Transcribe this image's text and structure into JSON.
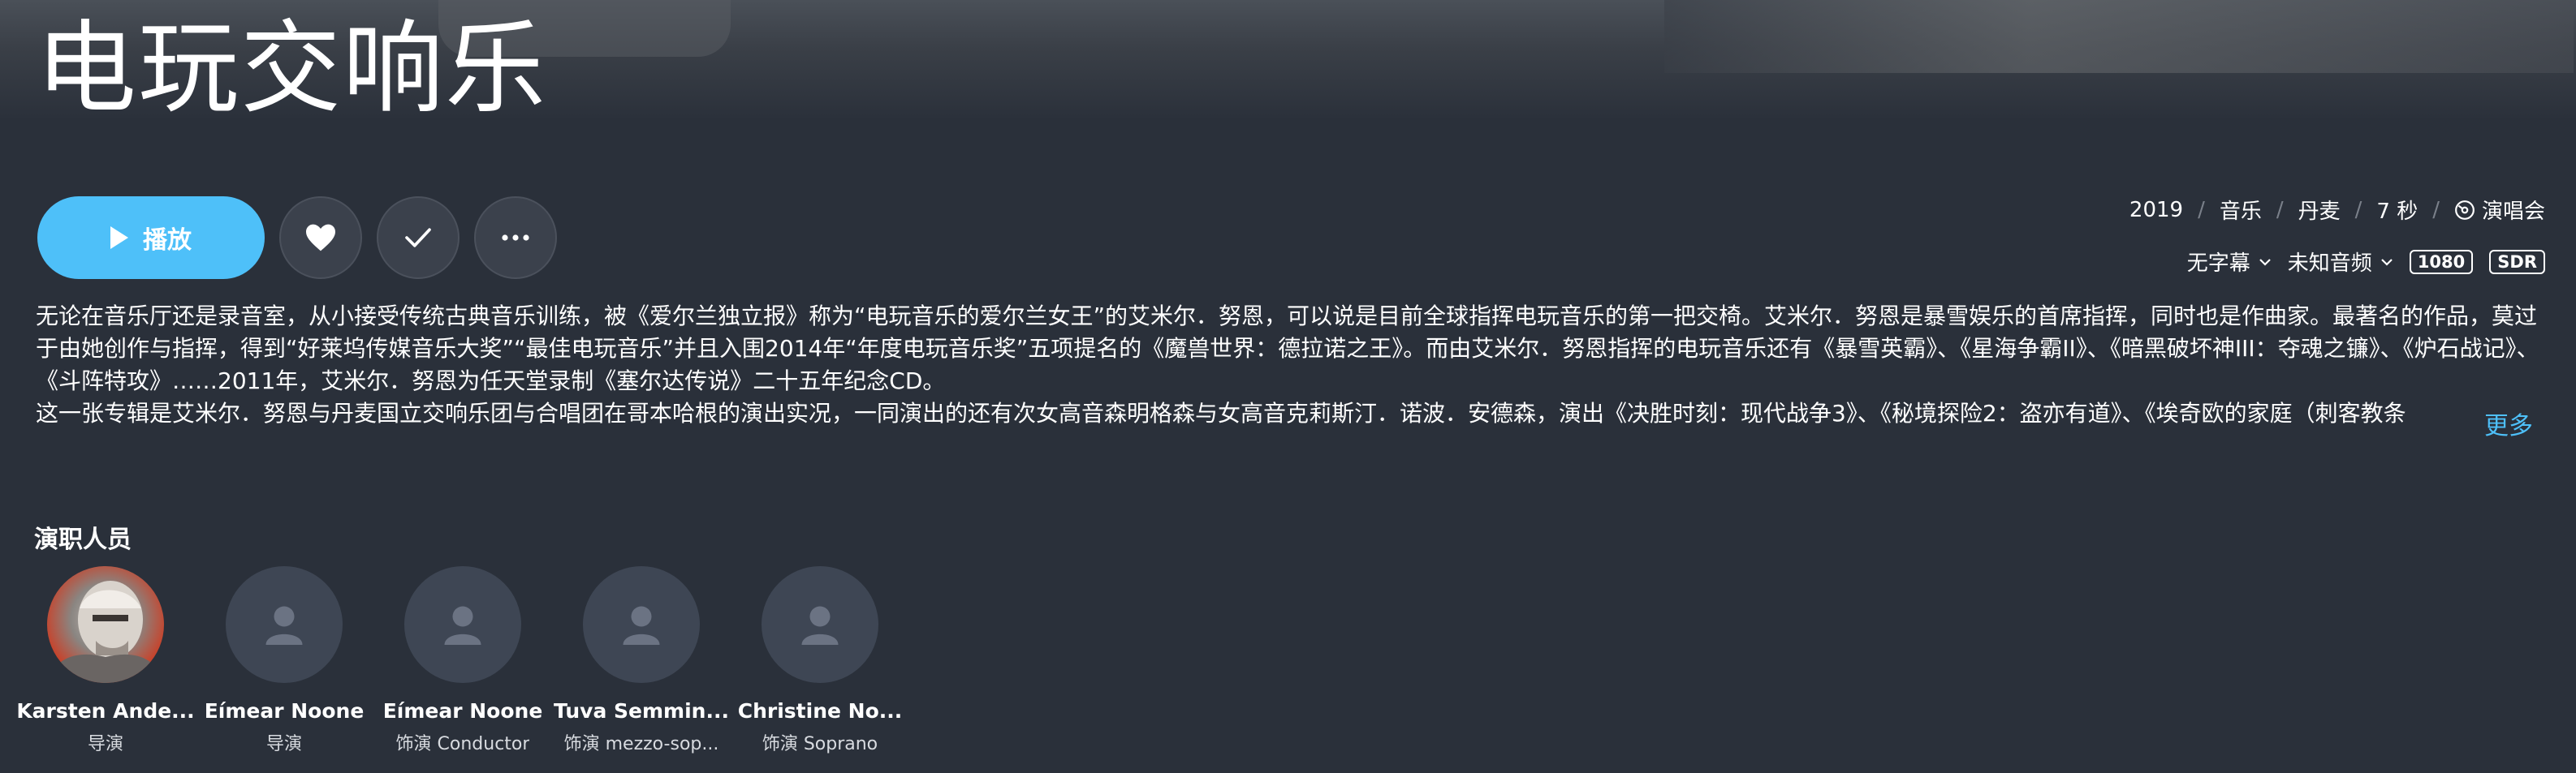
{
  "title": "电玩交响乐",
  "actions": {
    "play_label": "播放",
    "play_icon": "play-icon",
    "favorite_icon": "heart-icon",
    "watched_icon": "check-icon",
    "more_icon": "more-icon"
  },
  "meta": {
    "year": "2019",
    "genre": "音乐",
    "country": "丹麦",
    "duration": "7 秒",
    "type": "演唱会",
    "type_icon": "concert-icon",
    "subtitle": "无字幕",
    "audio": "未知音频",
    "resolution": "1080",
    "dynamic_range": "SDR"
  },
  "description": {
    "paragraph1": "无论在音乐厅还是录音室，从小接受传统古典音乐训练，被《爱尔兰独立报》称为“电玩音乐的爱尔兰女王”的艾米尔．努恩，可以说是目前全球指挥电玩音乐的第一把交椅。艾米尔．努恩是暴雪娱乐的首席指挥，同时也是作曲家。最著名的作品，莫过于由她创作与指挥，得到“好莱坞传媒音乐大奖”“最佳电玩音乐”并且入围2014年“年度电玩音乐奖”五项提名的《魔兽世界：德拉诺之王》。而由艾米尔．努恩指挥的电玩音乐还有《暴雪英霸》、《星海争霸II》、《暗黑破坏神III：夺魂之镰》、《炉石战记》、《斗阵特攻》……2011年，艾米尔．努恩为任天堂录制《塞尔达传说》二十五年纪念CD。",
    "paragraph2": "这一张专辑是艾米尔．努恩与丹麦国立交响乐团与合唱团在哥本哈根的演出实况，一同演出的还有次女高音森明格森与女高音克莉斯汀．诺波．安德森，演出《决胜时刻：现代战争3》、《秘境探险2：盗亦有道》、《埃奇欧的家庭（刺客教条",
    "more_label": "更多"
  },
  "cast_section": {
    "title": "演职人员",
    "people": [
      {
        "name": "Karsten Ande...",
        "role": "导演",
        "avatar": "photo"
      },
      {
        "name": "Eímear Noone",
        "role": "导演",
        "avatar": "person-icon"
      },
      {
        "name": "Eímear Noone",
        "role": "饰演 Conductor",
        "avatar": "person-icon"
      },
      {
        "name": "Tuva Semmin...",
        "role": "饰演 mezzo-sop...",
        "avatar": "person-icon"
      },
      {
        "name": "Christine No...",
        "role": "饰演 Soprano",
        "avatar": "person-icon"
      }
    ]
  },
  "colors": {
    "background": "#2a303a",
    "accent": "#4ec0f9",
    "button_bg": "#3b414c",
    "avatar_placeholder": "#3e4654"
  }
}
